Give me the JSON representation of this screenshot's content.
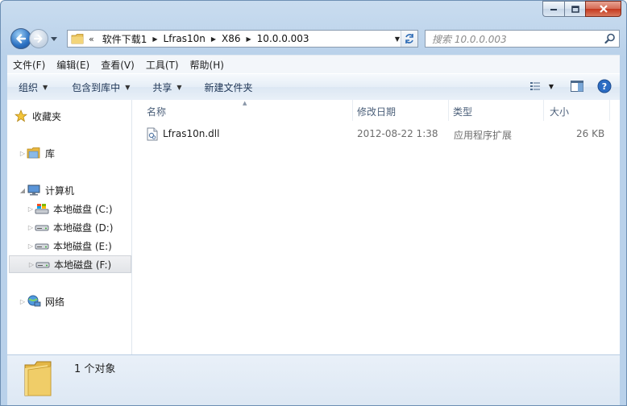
{
  "address": {
    "overflow": "«",
    "crumbs": [
      "软件下载1",
      "Lfras10n",
      "X86",
      "10.0.0.003"
    ]
  },
  "search": {
    "placeholder": "搜索 10.0.0.003"
  },
  "menu": [
    "文件(F)",
    "编辑(E)",
    "查看(V)",
    "工具(T)",
    "帮助(H)"
  ],
  "toolbar": {
    "organize": "组织",
    "include_in_library": "包含到库中",
    "share": "共享",
    "new_folder": "新建文件夹"
  },
  "sidebar": {
    "favorites": "收藏夹",
    "libraries": "库",
    "computer": "计算机",
    "drives": [
      "本地磁盘 (C:)",
      "本地磁盘 (D:)",
      "本地磁盘 (E:)",
      "本地磁盘 (F:)"
    ],
    "network": "网络"
  },
  "columns": {
    "name": "名称",
    "modified": "修改日期",
    "type": "类型",
    "size": "大小"
  },
  "files": [
    {
      "name": "Lfras10n.dll",
      "modified": "2012-08-22 1:38",
      "type": "应用程序扩展",
      "size": "26 KB"
    }
  ],
  "details": {
    "count": "1 个对象"
  },
  "colors": {
    "accent": "#2c72c3",
    "close": "#c4381e",
    "folder": "#e8c15a"
  }
}
